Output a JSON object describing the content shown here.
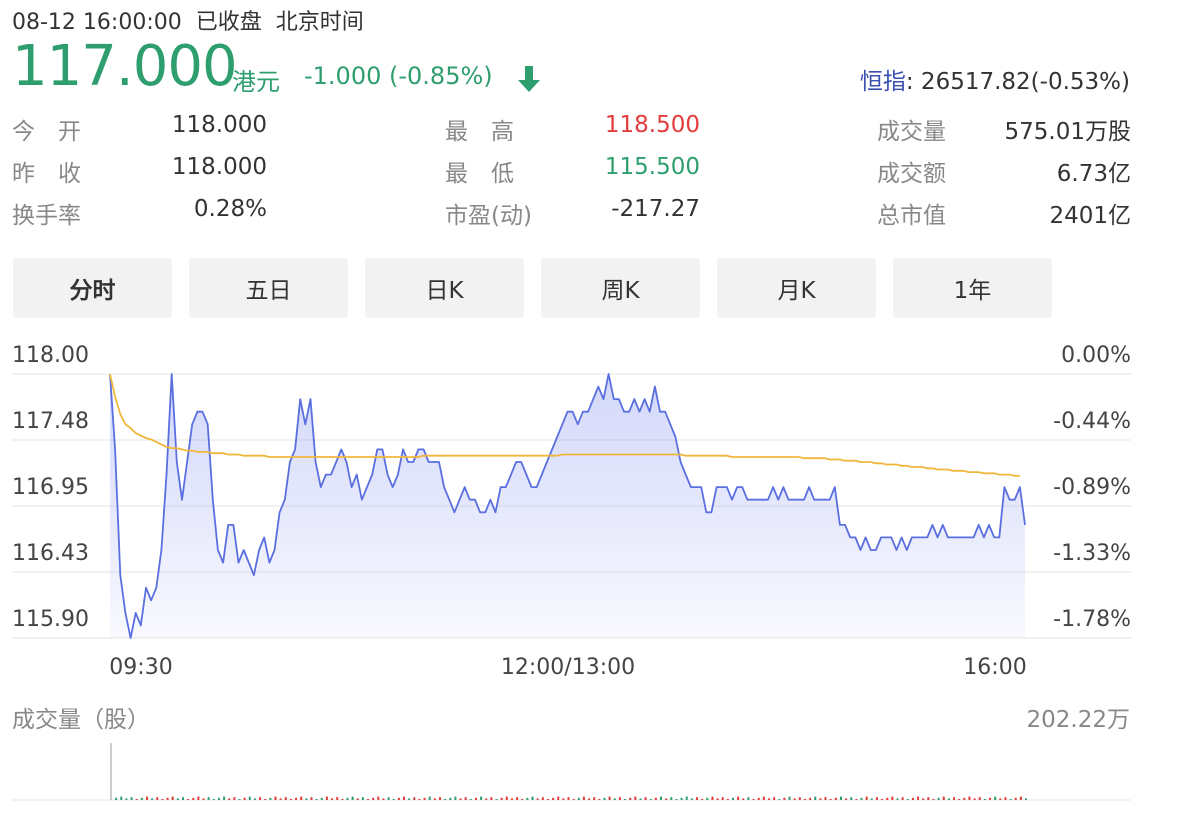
{
  "header": {
    "status": "08-12 16:00:00  已收盘  北京时间",
    "price": "117.000",
    "currency": "港元",
    "change": "-1.000 (-0.85%)",
    "arrow_icon": "down-arrow-icon",
    "index_name": "恒指",
    "index_value": ": 26517.82(-0.53%)"
  },
  "stats": {
    "col1": [
      {
        "label": "今　开",
        "value": "118.000"
      },
      {
        "label": "昨　收",
        "value": "118.000"
      },
      {
        "label": "换手率",
        "value": "0.28%"
      }
    ],
    "col2": [
      {
        "label": "最　高",
        "value": "118.500",
        "color": "#e23c3c"
      },
      {
        "label": "最　低",
        "value": "115.500",
        "color": "#2f9e6e"
      },
      {
        "label": "市盈(动)",
        "value": "-217.27"
      }
    ],
    "col3": [
      {
        "label": "成交量",
        "value": "575.01万股"
      },
      {
        "label": "成交额",
        "value": "6.73亿"
      },
      {
        "label": "总市值",
        "value": "2401亿"
      }
    ]
  },
  "tabs": [
    "分时",
    "五日",
    "日K",
    "周K",
    "月K",
    "1年"
  ],
  "active_tab": "分时",
  "colors": {
    "up": "#e23c3c",
    "down": "#2f9e6e",
    "price_line": "#5a6fe0",
    "avg_line": "#f0b73c"
  },
  "chart_data": {
    "type": "line",
    "y_left_ticks": [
      "118.00",
      "117.48",
      "116.95",
      "116.43",
      "115.90"
    ],
    "y_right_ticks": [
      "0.00%",
      "-0.44%",
      "-0.89%",
      "-1.33%",
      "-1.78%"
    ],
    "x_ticks": [
      "09:30",
      "12:00/13:00",
      "16:00"
    ],
    "ylim": [
      115.9,
      118.0
    ],
    "series": [
      {
        "values": [
          118.0,
          117.4,
          116.4,
          116.1,
          115.9,
          116.1,
          116.0,
          116.3,
          116.2,
          116.3,
          116.6,
          117.2,
          118.0,
          117.3,
          117.0,
          117.3,
          117.6,
          117.7,
          117.7,
          117.6,
          117.0,
          116.6,
          116.5,
          116.8,
          116.8,
          116.5,
          116.6,
          116.5,
          116.4,
          116.6,
          116.7,
          116.5,
          116.6,
          116.9,
          117.0,
          117.3,
          117.4,
          117.8,
          117.6,
          117.8,
          117.3,
          117.1,
          117.2,
          117.2,
          117.3,
          117.4,
          117.3,
          117.1,
          117.2,
          117.0,
          117.1,
          117.2,
          117.4,
          117.4,
          117.2,
          117.1,
          117.2,
          117.4,
          117.3,
          117.3,
          117.4,
          117.4,
          117.3,
          117.3,
          117.3,
          117.1,
          117.0,
          116.9,
          117.0,
          117.1,
          117.0,
          117.0,
          116.9,
          116.9,
          117.0,
          116.9,
          117.1,
          117.1,
          117.2,
          117.3,
          117.3,
          117.2,
          117.1,
          117.1,
          117.2,
          117.3,
          117.4,
          117.5,
          117.6,
          117.7,
          117.7,
          117.6,
          117.7,
          117.7,
          117.8,
          117.9,
          117.8,
          118.0,
          117.8,
          117.8,
          117.7,
          117.7,
          117.8,
          117.7,
          117.8,
          117.7,
          117.9,
          117.7,
          117.7,
          117.6,
          117.5,
          117.3,
          117.2,
          117.1,
          117.1,
          117.1,
          116.9,
          116.9,
          117.1,
          117.1,
          117.1,
          117.0,
          117.1,
          117.1,
          117.0,
          117.0,
          117.0,
          117.0,
          117.0,
          117.1,
          117.0,
          117.1,
          117.0,
          117.0,
          117.0,
          117.0,
          117.1,
          117.0,
          117.0,
          117.0,
          117.0,
          117.1,
          116.8,
          116.8,
          116.7,
          116.7,
          116.6,
          116.7,
          116.6,
          116.6,
          116.7,
          116.7,
          116.7,
          116.6,
          116.7,
          116.6,
          116.7,
          116.7,
          116.7,
          116.7,
          116.8,
          116.7,
          116.8,
          116.7,
          116.7,
          116.7,
          116.7,
          116.7,
          116.7,
          116.8,
          116.7,
          116.8,
          116.7,
          116.7,
          117.1,
          117.0,
          117.0,
          117.1,
          116.8
        ],
        "avg": [
          118.0,
          117.82,
          117.68,
          117.6,
          117.57,
          117.53,
          117.51,
          117.49,
          117.48,
          117.46,
          117.44,
          117.42,
          117.41,
          117.41,
          117.4,
          117.39,
          117.39,
          117.38,
          117.38,
          117.38,
          117.37,
          117.37,
          117.37,
          117.36,
          117.36,
          117.36,
          117.35,
          117.35,
          117.35,
          117.35,
          117.35,
          117.34,
          117.34,
          117.34,
          117.34,
          117.34,
          117.34,
          117.34,
          117.34,
          117.34,
          117.34,
          117.34,
          117.34,
          117.34,
          117.34,
          117.34,
          117.34,
          117.34,
          117.34,
          117.34,
          117.34,
          117.34,
          117.34,
          117.34,
          117.34,
          117.34,
          117.34,
          117.34,
          117.34,
          117.34,
          117.34,
          117.35,
          117.35,
          117.35,
          117.35,
          117.35,
          117.35,
          117.35,
          117.35,
          117.35,
          117.35,
          117.35,
          117.35,
          117.35,
          117.35,
          117.35,
          117.35,
          117.35,
          117.35,
          117.35,
          117.35,
          117.35,
          117.35,
          117.35,
          117.35,
          117.35,
          117.35,
          117.35,
          117.36,
          117.36,
          117.36,
          117.36,
          117.36,
          117.36,
          117.36,
          117.36,
          117.36,
          117.36,
          117.36,
          117.36,
          117.36,
          117.36,
          117.36,
          117.36,
          117.36,
          117.36,
          117.36,
          117.36,
          117.36,
          117.36,
          117.36,
          117.36,
          117.35,
          117.35,
          117.35,
          117.35,
          117.35,
          117.35,
          117.35,
          117.35,
          117.35,
          117.34,
          117.34,
          117.34,
          117.34,
          117.34,
          117.34,
          117.34,
          117.34,
          117.34,
          117.34,
          117.34,
          117.34,
          117.34,
          117.34,
          117.33,
          117.33,
          117.33,
          117.33,
          117.33,
          117.32,
          117.32,
          117.32,
          117.31,
          117.31,
          117.31,
          117.3,
          117.3,
          117.3,
          117.29,
          117.29,
          117.28,
          117.28,
          117.28,
          117.27,
          117.27,
          117.26,
          117.26,
          117.26,
          117.25,
          117.25,
          117.24,
          117.24,
          117.24,
          117.23,
          117.23,
          117.23,
          117.22,
          117.22,
          117.22,
          117.21,
          117.21,
          117.21,
          117.2,
          117.2,
          117.2,
          117.19,
          117.19
        ]
      }
    ]
  },
  "volume": {
    "title": "成交量（股）",
    "max_label": "202.22万"
  }
}
